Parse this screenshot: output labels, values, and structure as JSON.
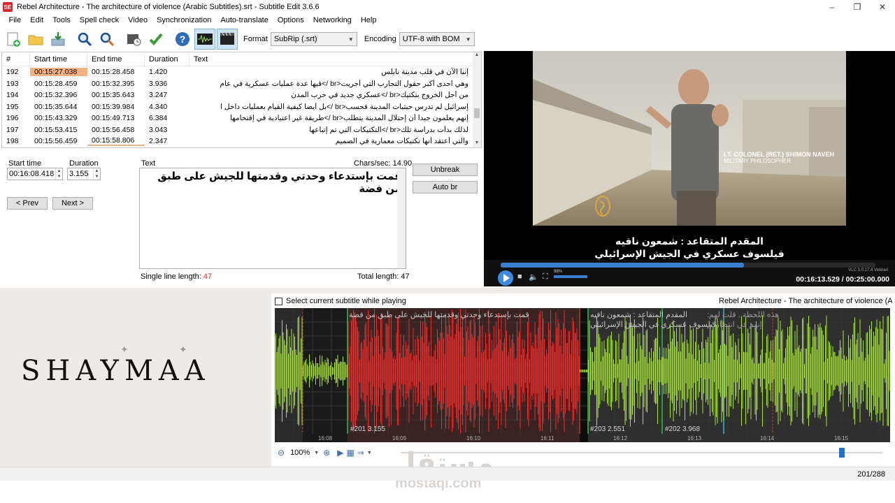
{
  "window": {
    "title": "Rebel Architecture - The architecture of violence (Arabic Subtitles).srt - Subtitle Edit 3.6.6",
    "app_icon_text": "SE"
  },
  "menu": [
    "File",
    "Edit",
    "Tools",
    "Spell check",
    "Video",
    "Synchronization",
    "Auto-translate",
    "Options",
    "Networking",
    "Help"
  ],
  "toolbar": {
    "format_label": "Format",
    "format_value": "SubRip (.srt)",
    "encoding_label": "Encoding",
    "encoding_value": "UTF-8 with BOM"
  },
  "list": {
    "headers": [
      "#",
      "Start time",
      "End time",
      "Duration",
      "Text"
    ],
    "rows": [
      {
        "num": "192",
        "start": "00:15:27.038",
        "end": "00:15:28.458",
        "dur": "1.420",
        "text": "إننا الآن في قلب مدينة نابلُس"
      },
      {
        "num": "193",
        "start": "00:15:28.459",
        "end": "00:15:32.395",
        "dur": "3.936",
        "text": "وهي احدى أكبر حقول التجارب التي أجريت<br />فيها عدة عمليات عسكرية في عام"
      },
      {
        "num": "194",
        "start": "00:15:32.396",
        "end": "00:15:35.643",
        "dur": "3.247",
        "text": "من أجل الخروج بتكتيك<br />عسكري جديد في حرب المدن"
      },
      {
        "num": "195",
        "start": "00:15:35.644",
        "end": "00:15:39.984",
        "dur": "4.340",
        "text": "إسرائيل لم تدرس حيثيات المدينة فحسب<br />بل أيضا كيفية القيام بعمليات داخل ا"
      },
      {
        "num": "196",
        "start": "00:15:43.329",
        "end": "00:15:49.713",
        "dur": "6.384",
        "text": "إنهم يعلمون جيدا أن إحتلال المدينة يتطلب<br />طريقة غير اعتيادية في إقتحامها"
      },
      {
        "num": "197",
        "start": "00:15:53.415",
        "end": "00:15:56.458",
        "dur": "3.043",
        "text": "لذلك بدأت بدراسة تلك<br />التكتيكات التي تم إتباعها"
      },
      {
        "num": "198",
        "start": "00:15:56.459",
        "end": "00:15:58.806",
        "dur": "2.347",
        "text": "والتي أعتقد أنها تكتيكات معمارية في الصميم"
      }
    ]
  },
  "edit": {
    "start_label": "Start time",
    "start_value": "00:16:08.418",
    "duration_label": "Duration",
    "duration_value": "3.155",
    "text_label": "Text",
    "chars_sec": "Chars/sec: 14.90",
    "text_value": "قمت بإستدعاء وحدتي وقدمتها للجيش على طبق من فضة",
    "unbreak": "Unbreak",
    "auto_br": "Auto br",
    "prev": "< Prev",
    "next": "Next >",
    "single_line_label": "Single line length:",
    "single_line_value": "47",
    "total_length_label": "Total length:",
    "total_length_value": "47"
  },
  "video": {
    "lower_third_1": "LT. COLONEL (RET.) SHIMON NAVEH",
    "lower_third_2": "MILITARY PHILOSOPHER",
    "sub_line_1": "المقدم المتقاعد : شمعون نافيه",
    "sub_line_2": "فيلسوف عسكري في الجيش الإسرائيلي",
    "time": "00:16:13.529 / 00:25:00.000",
    "volume_pct": "98%",
    "vlc_version": "VLC 3.0.17.4 Vetinari",
    "progress": 0.65
  },
  "brand": {
    "name": "SHAYMAA"
  },
  "waveform": {
    "select_label": "Select current subtitle while playing",
    "title": "Rebel Architecture - The architecture of violence (Arabic",
    "sub_left": "قمت بإستدعاء وحدتي وقدمتها للجيش على طبق من فضة",
    "sub_right_1": "المقدم المتقاعد : شمعون نافيه",
    "sub_right_2": "فيلسوف عسكري في الجيش الإسرائيلي",
    "sub_overlap": "هذه اللحظة . قلت لهم:",
    "sub_overlap_2": "إنهم في انتظاركم",
    "seg1": "#201  3.155",
    "seg2": "#203  2.551",
    "seg3": "#202  3.968",
    "ticks": [
      "16:08",
      "16:09",
      "16:10",
      "16:11",
      "16:12",
      "16:13",
      "16:14",
      "16:15"
    ],
    "zoom": "100%"
  },
  "watermark": {
    "arabic": "مستقل",
    "latin": "mostaql.com"
  },
  "status": {
    "count": "201/288"
  }
}
